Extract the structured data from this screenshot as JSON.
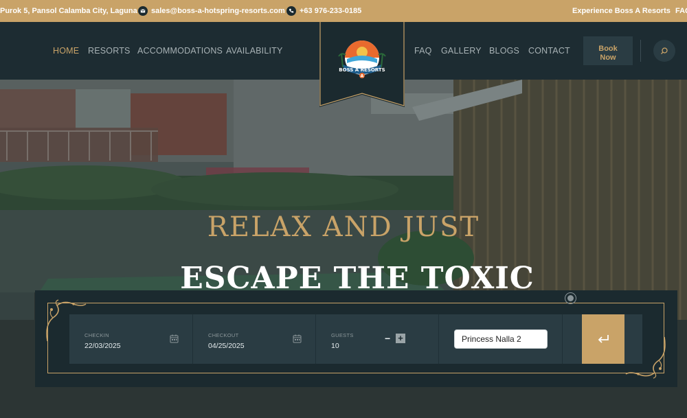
{
  "topbar": {
    "address": "Purok 5, Pansol Calamba City, Laguna",
    "email": "sales@boss-a-hotspring-resorts.com",
    "phone": "+63 976-233-0185",
    "experience_link": "Experience Boss A Resorts",
    "faq_link": "FAQ"
  },
  "nav": {
    "items": [
      "HOME",
      "RESORTS",
      "ACCOMMODATIONS",
      "AVAILABILITY",
      "FAQ",
      "GALLERY",
      "BLOGS",
      "CONTACT"
    ],
    "active": "HOME",
    "book_now_line1": "Book",
    "book_now_line2": "Now"
  },
  "logo": {
    "text": "BOSS A RESORTS",
    "letter": "A"
  },
  "hero": {
    "subtitle": "RELAX AND JUST",
    "title": "ESCAPE THE TOXIC LIFE"
  },
  "booking": {
    "checkin_label": "CHECKIN",
    "checkin_value": "22/03/2025",
    "checkout_label": "CHECKOUT",
    "checkout_value": "04/25/2025",
    "guests_label": "GUESTS",
    "guests_value": "10",
    "resort_selected": "Princess Nalla 2"
  },
  "colors": {
    "accent_gold": "#c9a368",
    "dark_navy": "#1b2a2f",
    "field_bg": "#2a3c43"
  }
}
